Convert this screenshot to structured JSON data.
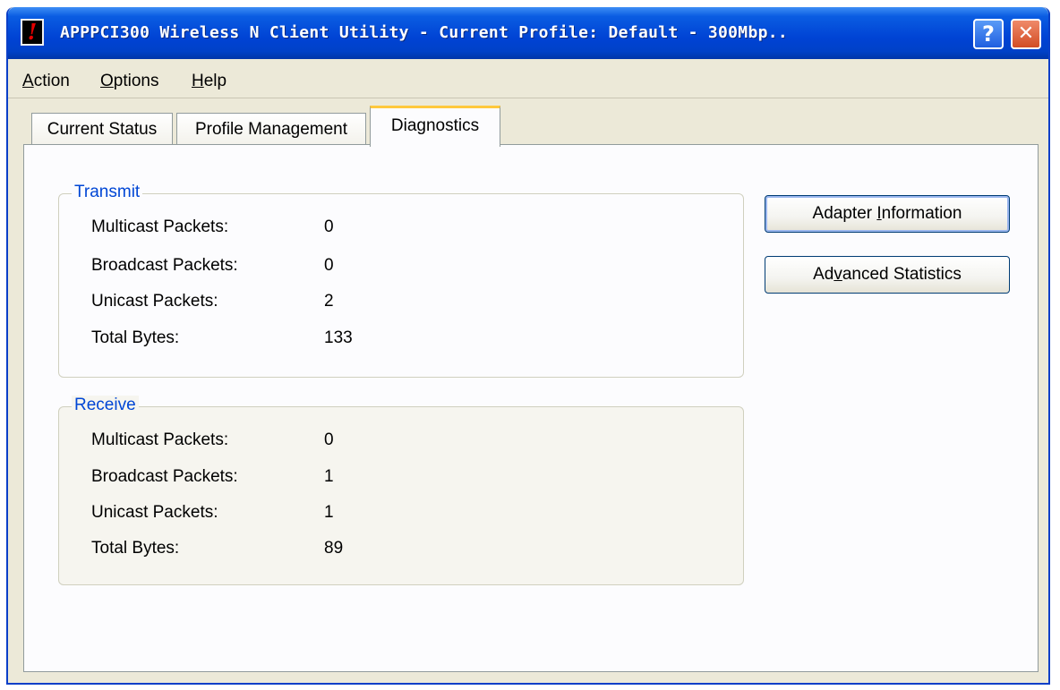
{
  "window": {
    "title": "APPPCI300 Wireless N Client Utility - Current Profile: Default - 300Mbp..",
    "help_button": "?",
    "close_button": "✕"
  },
  "menu": {
    "items": [
      {
        "accel": "A",
        "rest": "ction"
      },
      {
        "accel": "O",
        "rest": "ptions"
      },
      {
        "accel": "H",
        "rest": "elp"
      }
    ]
  },
  "tabs": [
    {
      "label": "Current Status",
      "active": false
    },
    {
      "label": "Profile Management",
      "active": false
    },
    {
      "label": "Diagnostics",
      "active": true
    }
  ],
  "transmit": {
    "title": "Transmit",
    "rows": [
      {
        "label": "Multicast Packets:",
        "value": "0"
      },
      {
        "label": "Broadcast Packets:",
        "value": "0"
      },
      {
        "label": "Unicast Packets:",
        "value": "2"
      },
      {
        "label": "Total Bytes:",
        "value": "133"
      }
    ]
  },
  "receive": {
    "title": "Receive",
    "rows": [
      {
        "label": "Multicast Packets:",
        "value": "0"
      },
      {
        "label": "Broadcast Packets:",
        "value": "1"
      },
      {
        "label": "Unicast Packets:",
        "value": "1"
      },
      {
        "label": "Total Bytes:",
        "value": "89"
      }
    ]
  },
  "buttons": {
    "adapter_info": {
      "before": "Adapter ",
      "accel": "I",
      "after": "nformation"
    },
    "advanced_stats": {
      "before": "Ad",
      "accel": "v",
      "after": "anced Statistics"
    }
  },
  "colors": {
    "titlebar": "#0043d4",
    "group_title": "#0046d5",
    "tab_highlight": "#ffc83c",
    "close_button": "#d24d24"
  }
}
